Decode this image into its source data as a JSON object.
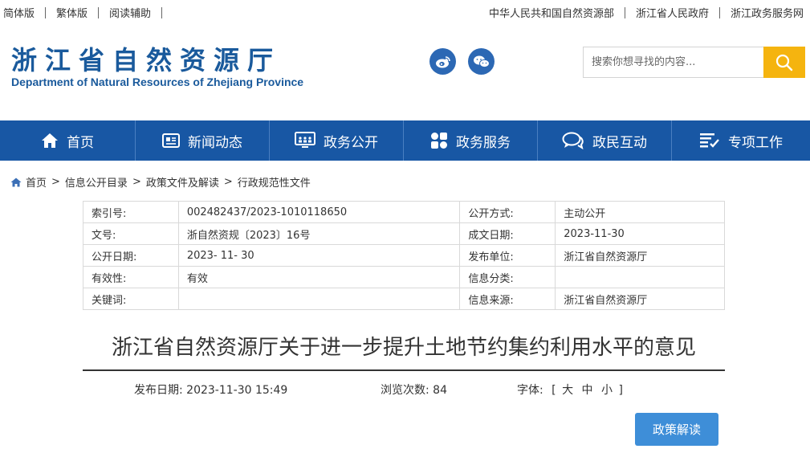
{
  "topbar": {
    "left_links": [
      "简体版",
      "繁体版",
      "阅读辅助"
    ],
    "right_links": [
      "中华人民共和国自然资源部",
      "浙江省人民政府",
      "浙江政务服务网"
    ]
  },
  "header": {
    "title_cn": "浙江省自然资源厅",
    "title_en": "Department of Natural Resources of Zhejiang Province",
    "weibo_icon": "weibo-icon",
    "wechat_icon": "wechat-icon"
  },
  "search": {
    "placeholder": "搜索你想寻找的内容...",
    "value": ""
  },
  "nav": {
    "items": [
      {
        "label": "首页",
        "icon": "home-icon"
      },
      {
        "label": "新闻动态",
        "icon": "news-icon"
      },
      {
        "label": "政务公开",
        "icon": "monitor-icon"
      },
      {
        "label": "政务服务",
        "icon": "grid-icon"
      },
      {
        "label": "政民互动",
        "icon": "chat-icon"
      },
      {
        "label": "专项工作",
        "icon": "list-icon"
      }
    ]
  },
  "breadcrumb": [
    "首页",
    "信息公开目录",
    "政策文件及解读",
    "行政规范性文件"
  ],
  "meta": {
    "rows": [
      [
        "索引号:",
        "002482437/2023-1010118650",
        "公开方式:",
        "主动公开"
      ],
      [
        "文号:",
        "浙自然资规〔2023〕16号",
        "成文日期:",
        "2023-11-30"
      ],
      [
        "公开日期:",
        "2023- 11- 30",
        "发布单位:",
        "浙江省自然资源厅"
      ],
      [
        "有效性:",
        "有效",
        "信息分类:",
        ""
      ],
      [
        "关键词:",
        "",
        "信息来源:",
        "浙江省自然资源厅"
      ]
    ]
  },
  "document": {
    "title": "浙江省自然资源厅关于进一步提升土地节约集约利用水平的意见",
    "publish_date": "发布日期: 2023-11-30 15:49",
    "views": "浏览次数: 84",
    "font_label": "字体:",
    "font_open": "[",
    "font_large": "大",
    "font_medium": "中",
    "font_small": "小",
    "font_close": "]"
  },
  "policy_button": "政策解读",
  "colors": {
    "brand_blue": "#1a5a9c",
    "nav_bg": "#1857a4",
    "search_btn": "#f5b40f",
    "policy_btn": "#3e8ed8"
  }
}
